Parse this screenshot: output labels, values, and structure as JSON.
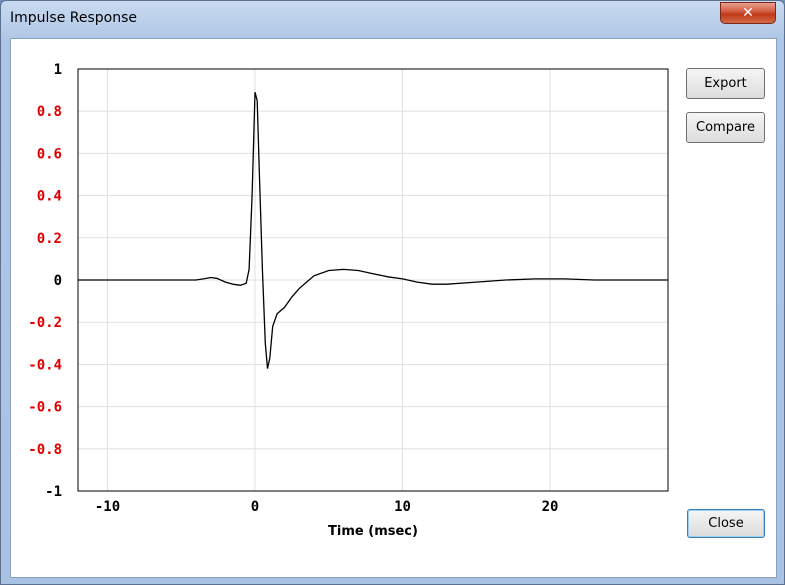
{
  "window": {
    "title": "Impulse Response",
    "close_glyph": "✕"
  },
  "buttons": {
    "export": "Export",
    "compare": "Compare",
    "close": "Close"
  },
  "colors": {
    "negative_tick": "#e00000",
    "axis_tick": "#000000",
    "grid": "#e0e0e0",
    "trace": "#000000"
  },
  "chart_data": {
    "type": "line",
    "title": "",
    "xlabel": "Time (msec)",
    "ylabel": "",
    "xlim": [
      -12,
      28
    ],
    "ylim": [
      -1,
      1
    ],
    "grid": true,
    "x_ticks": [
      -10,
      0,
      10,
      20
    ],
    "x_tick_labels": [
      "-10",
      "0",
      "10",
      "20"
    ],
    "y_ticks": [
      1,
      0.8,
      0.6,
      0.4,
      0.2,
      0,
      -0.2,
      -0.4,
      -0.6,
      -0.8,
      -1
    ],
    "y_tick_labels": [
      "1",
      "0.8",
      "0.6",
      "0.4",
      "0.2",
      "0",
      "-0.2",
      "-0.4",
      "-0.6",
      "-0.8",
      "-1"
    ],
    "series": [
      {
        "x": [
          -12,
          -4,
          -3.5,
          -3,
          -2.6,
          -2,
          -1.5,
          -1,
          -0.6,
          -0.4,
          -0.2,
          0,
          0.15,
          0.3,
          0.5,
          0.7,
          0.85,
          1.0,
          1.2,
          1.5,
          2,
          2.5,
          3,
          3.5,
          4,
          5,
          6,
          7,
          8,
          9,
          10,
          11,
          12,
          13,
          15,
          17,
          19,
          21,
          23,
          25,
          28
        ],
        "y": [
          0,
          0,
          0.005,
          0.012,
          0.008,
          -0.01,
          -0.02,
          -0.025,
          -0.015,
          0.05,
          0.4,
          0.89,
          0.85,
          0.5,
          0.05,
          -0.3,
          -0.42,
          -0.37,
          -0.22,
          -0.16,
          -0.13,
          -0.08,
          -0.04,
          -0.01,
          0.02,
          0.045,
          0.05,
          0.045,
          0.03,
          0.015,
          0.005,
          -0.01,
          -0.02,
          -0.02,
          -0.01,
          0.0,
          0.005,
          0.005,
          0.0,
          0.0,
          0.0
        ]
      }
    ]
  }
}
